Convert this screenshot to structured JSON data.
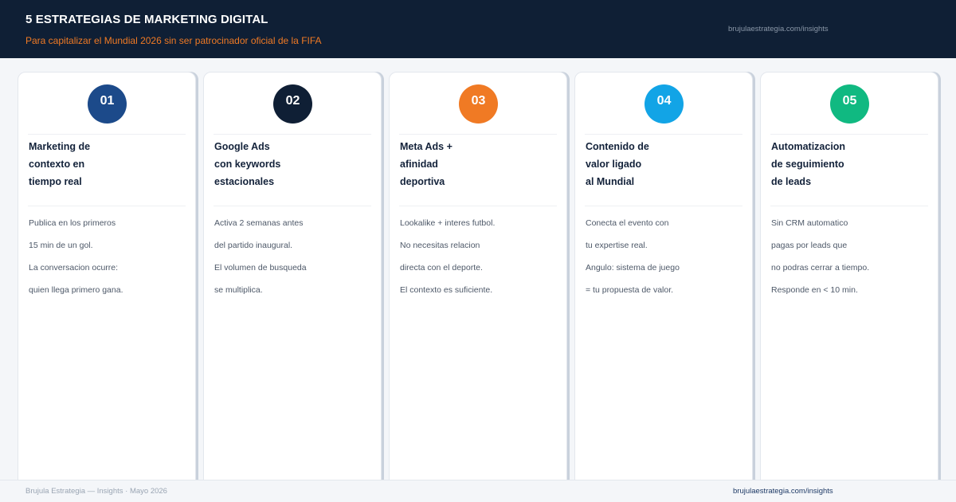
{
  "header": {
    "title": "5 ESTRATEGIAS DE MARKETING DIGITAL",
    "subtitle": "Para capitalizar el Mundial 2026 sin ser patrocinador oficial de la FIFA",
    "url": "brujulaestrategia.com/insights"
  },
  "cards": [
    {
      "number": "01",
      "color": "#1c4a8a",
      "title": [
        "Marketing de",
        "contexto en",
        "tiempo real"
      ],
      "description": [
        "Publica en los primeros",
        "15 min de un gol.",
        "La conversacion ocurre:",
        "quien llega primero gana."
      ]
    },
    {
      "number": "02",
      "color": "#0f1f35",
      "title": [
        "Google Ads",
        "con keywords",
        "estacionales"
      ],
      "description": [
        "Activa 2 semanas antes",
        "del partido inaugural.",
        "El volumen de busqueda",
        "se multiplica."
      ]
    },
    {
      "number": "03",
      "color": "#f07a24",
      "title": [
        "Meta Ads +",
        "afinidad",
        "deportiva"
      ],
      "description": [
        "Lookalike + interes futbol.",
        "No necesitas relacion",
        "directa con el deporte.",
        "El contexto es suficiente."
      ]
    },
    {
      "number": "04",
      "color": "#12a4e6",
      "title": [
        "Contenido de",
        "valor ligado",
        "al Mundial"
      ],
      "description": [
        "Conecta el evento con",
        "tu expertise real.",
        "Angulo: sistema de juego",
        "= tu propuesta de valor."
      ]
    },
    {
      "number": "05",
      "color": "#10b981",
      "title": [
        "Automatizacion",
        "de seguimiento",
        "de leads"
      ],
      "description": [
        "Sin CRM automatico",
        "pagas por leads que",
        "no podras cerrar a tiempo.",
        "Responde en < 10 min."
      ]
    }
  ],
  "footer": {
    "left": "Brujula Estrategia — Insights · Mayo 2026",
    "right": "brujulaestrategia.com/insights"
  }
}
